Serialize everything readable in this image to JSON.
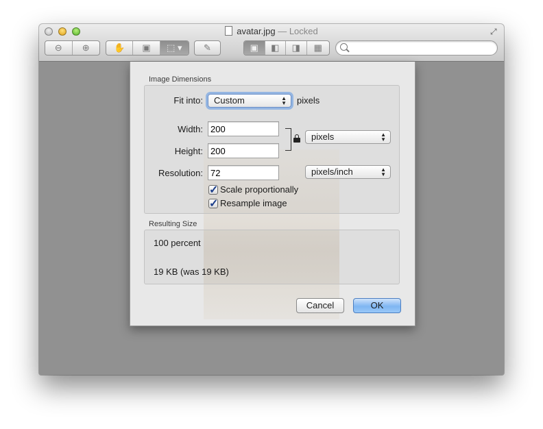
{
  "window": {
    "title": "avatar.jpg",
    "title_status": "— Locked"
  },
  "toolbar": {
    "buttons": [
      "zoom-out",
      "zoom-in",
      "hand-tool",
      "text-tool",
      "selection-tool",
      "annotate",
      "view-content",
      "view-thumbnails",
      "view-toc",
      "view-contact-sheet"
    ],
    "search_placeholder": ""
  },
  "dialog": {
    "image_dimensions_label": "Image Dimensions",
    "fit_into_label": "Fit into:",
    "fit_into_value": "Custom",
    "fit_into_unit": "pixels",
    "width_label": "Width:",
    "width_value": "200",
    "height_label": "Height:",
    "height_value": "200",
    "size_unit_value": "pixels",
    "resolution_label": "Resolution:",
    "resolution_value": "72",
    "resolution_unit_value": "pixels/inch",
    "scale_proportionally_label": "Scale proportionally",
    "scale_proportionally_checked": true,
    "resample_label": "Resample image",
    "resample_checked": true,
    "resulting_size_label": "Resulting Size",
    "result_percent": "100 percent",
    "result_filesize": "19 KB (was 19 KB)",
    "cancel_label": "Cancel",
    "ok_label": "OK"
  },
  "colors": {
    "default_button": "#7fb6f2",
    "window_content": "#919191"
  }
}
